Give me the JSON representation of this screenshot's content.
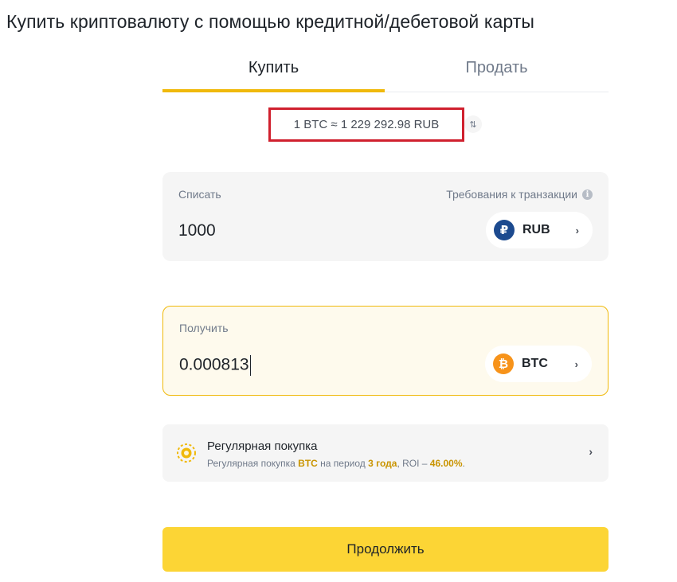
{
  "page": {
    "title": "Купить криптовалюту с помощью кредитной/дебетовой карты"
  },
  "tabs": [
    {
      "label": "Купить",
      "active": true
    },
    {
      "label": "Продать",
      "active": false
    }
  ],
  "rate": {
    "text": "1 BTC ≈ 1 229 292.98 RUB",
    "swap_icon": "⇅"
  },
  "spend": {
    "label": "Списать",
    "requirements_label": "Требования к транзакции",
    "info_icon": "i",
    "amount": "1000",
    "currency": {
      "code": "RUB",
      "symbol": "₽",
      "color": "#1c4a8f"
    }
  },
  "receive": {
    "label": "Получить",
    "amount": "0.000813",
    "currency": {
      "code": "BTC",
      "symbol": "₿",
      "color": "#f7931a"
    }
  },
  "recurring": {
    "title": "Регулярная покупка",
    "sub_prefix": "Регулярная покупка",
    "sub_coin": "BTC",
    "sub_mid": "на период",
    "sub_period": "3 года",
    "sub_roi_label": ", ROI –",
    "sub_roi_value": "46.00%",
    "sub_end": "."
  },
  "chevron": "›",
  "continue_label": "Продолжить",
  "colors": {
    "accent": "#f0b90b",
    "button": "#fcd535",
    "highlight_box": "#d0202e"
  }
}
